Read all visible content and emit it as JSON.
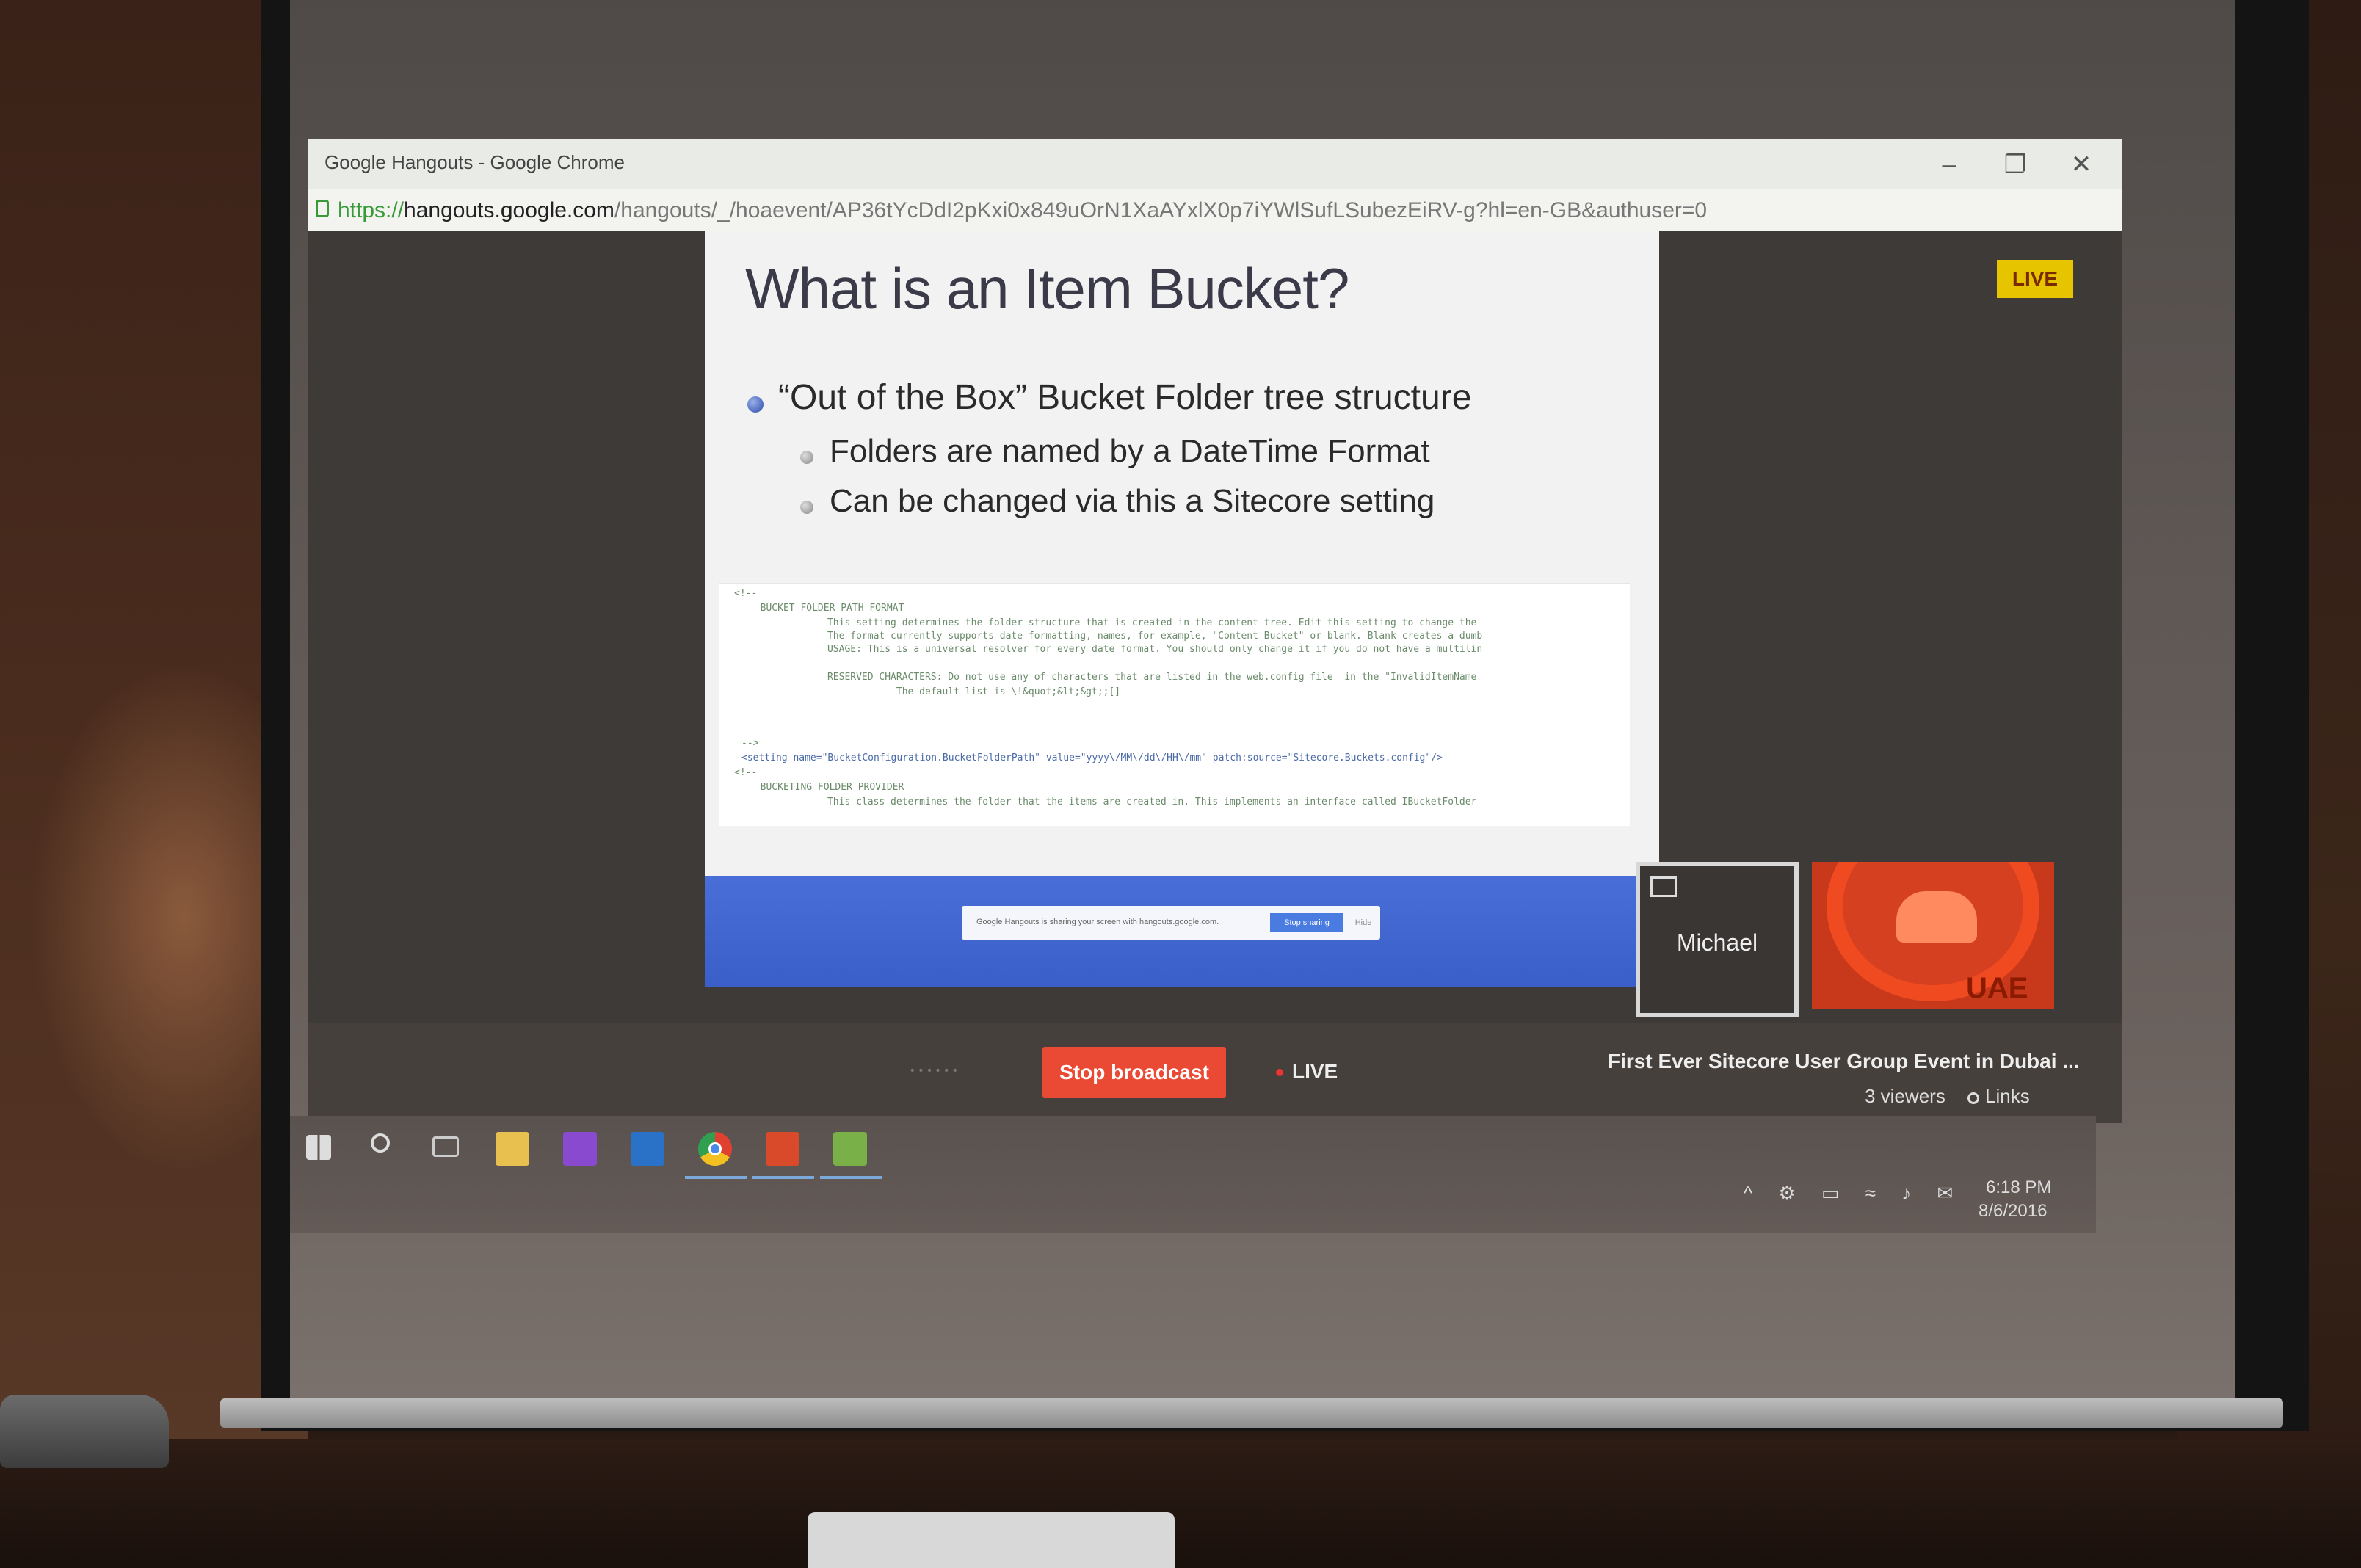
{
  "window": {
    "title": "Google Hangouts - Google Chrome",
    "url_protocol": "https://",
    "url_host": "hangouts.google.com",
    "url_path": "/hangouts/_/hoaevent/AP36tYcDdI2pKxi0x849uOrN1XaAYxlX0p7iYWlSufLSubezEiRV-g?hl=en-GB&authuser=0",
    "minimize_label": "–",
    "maximize_label": "❐",
    "close_label": "✕"
  },
  "slide": {
    "title": "What is an Item Bucket?",
    "bullets": [
      "“Out of the Box” Bucket Folder tree structure",
      "Folders are named by a DateTime Format",
      "Can be changed via this a Sitecore setting"
    ],
    "code_lines": [
      "<!--",
      "  BUCKET FOLDER PATH FORMAT",
      "      This setting determines the folder structure that is created in the content tree. Edit this setting to change the",
      "      The format currently supports date formatting, names, for example, \"Content Bucket\" or blank. Blank creates a dumb",
      "      USAGE: This is a universal resolver for every date format. You should only change it if you do not have a multilin",
      "      RESERVED CHARACTERS: Do not use any of characters that are listed in the web.config file  in the \"InvalidItemName",
      "                  The default list is \\!&quot;&lt;&gt;;[]",
      "-->",
      "<setting name=\"BucketConfiguration.BucketFolderPath\" value=\"yyyy\\/MM\\/dd\\/HH\\/mm\" patch:source=\"Sitecore.Buckets.config\"/>",
      "<!--",
      "  BUCKETING FOLDER PROVIDER",
      "      This class determines the folder that the items are created in. This implements an interface called IBucketFolder"
    ],
    "share_notice": "Google Hangouts is sharing your screen with hangouts.google.com.",
    "share_stop": "Stop sharing",
    "share_hide": "Hide"
  },
  "hangout": {
    "live_badge": "LIVE",
    "participant_name": "Michael",
    "uae_logo_text": "UAE",
    "stop_broadcast": "Stop broadcast",
    "live_indicator": "LIVE",
    "event_title": "First Ever Sitecore User Group Event in Dubai ...",
    "viewers": "3 viewers",
    "links": "Links"
  },
  "taskbar": {
    "apps": [
      "start-icon",
      "search-icon",
      "task-view-icon",
      "file-explorer-icon",
      "visual-studio-icon",
      "outlook-icon",
      "chrome-icon",
      "powerpoint-icon",
      "app-icon"
    ],
    "tray_icons": "^ ⚙ ▭ ≈ ♪ ✉",
    "time": "6:18 PM",
    "date": "8/6/2016"
  }
}
